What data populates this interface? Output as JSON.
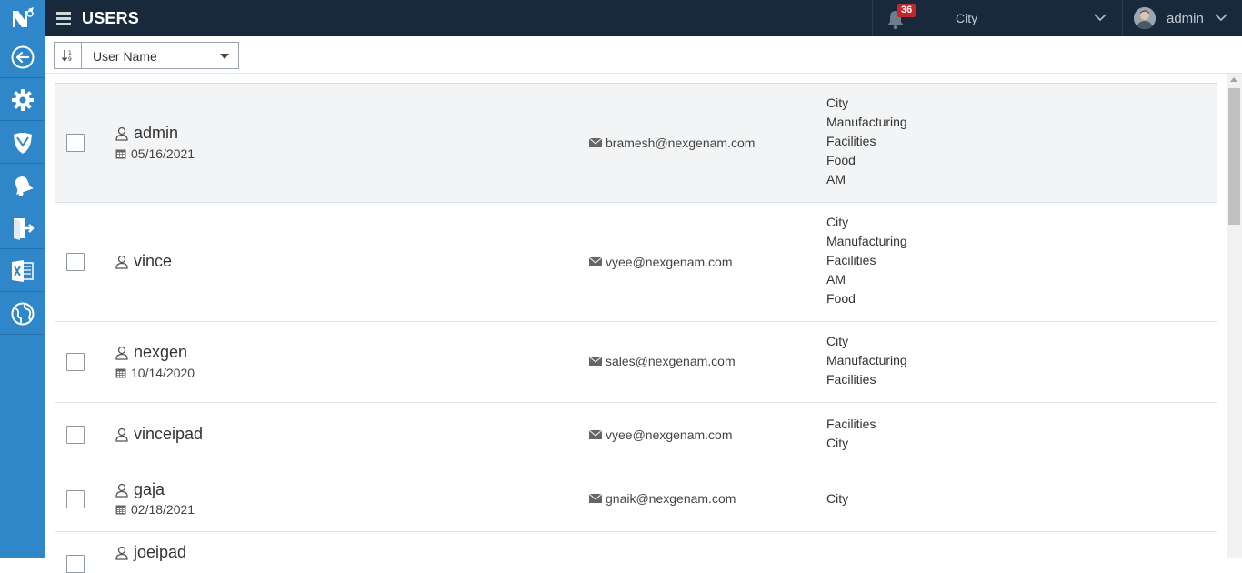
{
  "header": {
    "title": "USERS",
    "notifications_count": "36",
    "city_select": "City",
    "user_name": "admin"
  },
  "sidebar": {
    "items": [
      {
        "icon": "back-arrow-icon"
      },
      {
        "icon": "gear-icon"
      },
      {
        "icon": "shield-icon"
      },
      {
        "icon": "bell-icon"
      },
      {
        "icon": "logout-icon"
      },
      {
        "icon": "excel-icon"
      },
      {
        "icon": "globe-icon"
      }
    ]
  },
  "toolbar": {
    "sort_field": "User Name"
  },
  "users": [
    {
      "name": "admin",
      "date": "05/16/2021",
      "email": "bramesh@nexgenam.com",
      "groups": [
        "City",
        "Manufacturing",
        "Facilities",
        "Food",
        "AM"
      ]
    },
    {
      "name": "vince",
      "date": "",
      "email": "vyee@nexgenam.com",
      "groups": [
        "City",
        "Manufacturing",
        "Facilities",
        "AM",
        "Food"
      ]
    },
    {
      "name": "nexgen",
      "date": "10/14/2020",
      "email": "sales@nexgenam.com",
      "groups": [
        "City",
        "Manufacturing",
        "Facilities"
      ]
    },
    {
      "name": "vinceipad",
      "date": "",
      "email": "vyee@nexgenam.com",
      "groups": [
        "Facilities",
        "City"
      ]
    },
    {
      "name": "gaja",
      "date": "02/18/2021",
      "email": "gnaik@nexgenam.com",
      "groups": [
        "City"
      ]
    },
    {
      "name": "joeipad",
      "date": "",
      "email": "",
      "groups": []
    }
  ],
  "colors": {
    "sidebar": "#2f86c9",
    "header": "#18293c",
    "badge": "#c4262e"
  }
}
